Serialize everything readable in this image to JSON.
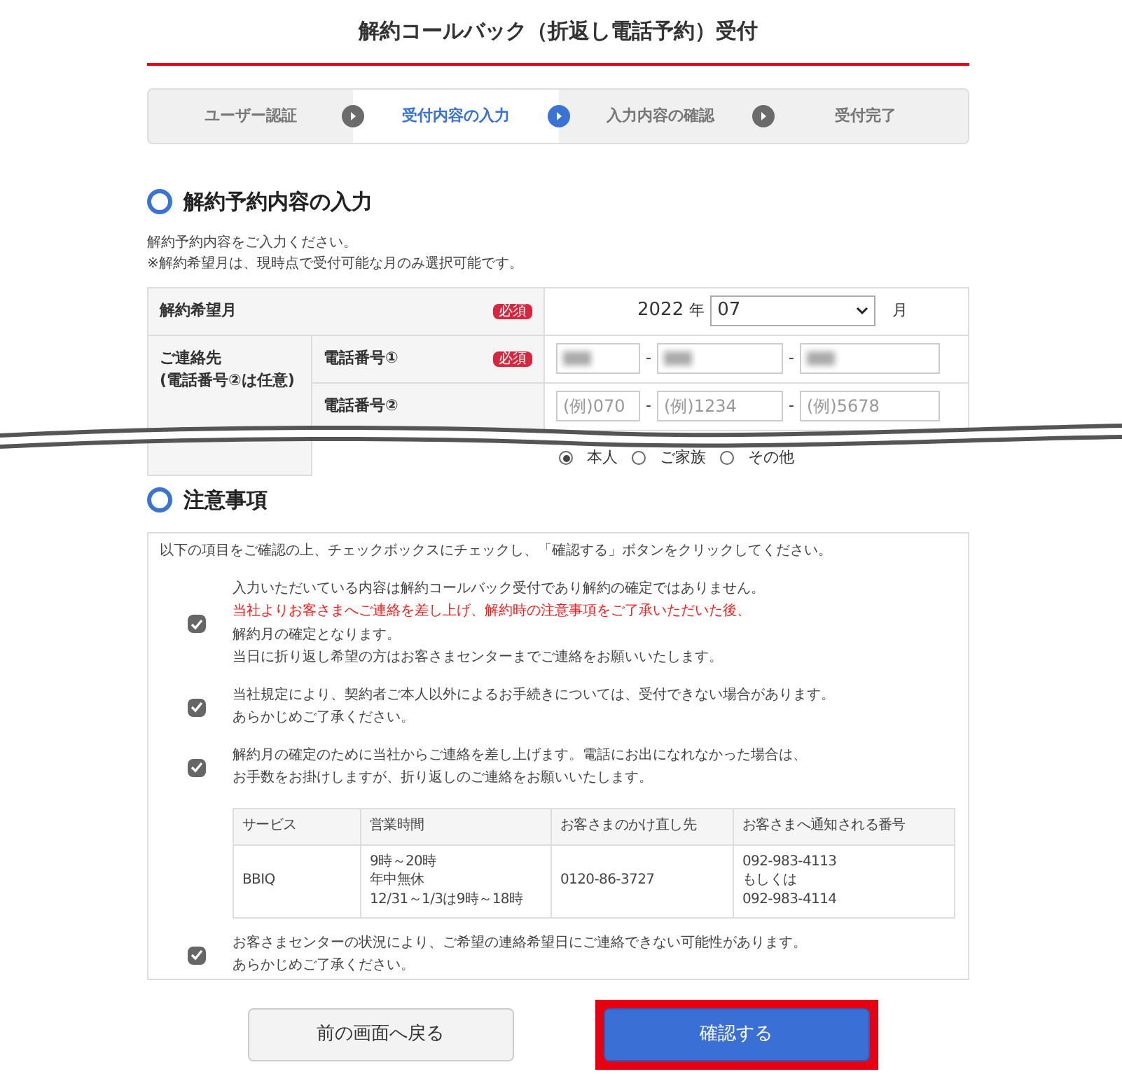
{
  "page_title": "解約コールバック（折返し電話予約）受付",
  "steps": [
    {
      "label": "ユーザー認証",
      "selected": false
    },
    {
      "label": "受付内容の入力",
      "selected": true
    },
    {
      "label": "入力内容の確認",
      "selected": false
    },
    {
      "label": "受付完了",
      "selected": false
    }
  ],
  "section1": {
    "heading": "解約予約内容の入力",
    "intro": [
      "解約予約内容をご入力ください。",
      "※解約希望月は、現時点で受付可能な月のみ選択可能です。"
    ],
    "month_row": {
      "label": "解約希望月",
      "badge": "必須",
      "year": "2022",
      "year_unit": "年",
      "month": "07",
      "month_unit": "月"
    },
    "contact": {
      "label": "ご連絡先",
      "note": "(電話番号②は任意)",
      "phones": [
        {
          "label": "電話番号①",
          "badge": "必須",
          "fields": [
            {
              "blurred": true
            },
            {
              "blurred": true
            },
            {
              "blurred": true
            }
          ],
          "separator": "-"
        },
        {
          "label": "電話番号②",
          "fields": [
            {
              "placeholder": "(例)070"
            },
            {
              "placeholder": "(例)1234"
            },
            {
              "placeholder": "(例)5678"
            }
          ],
          "separator": "-"
        }
      ]
    },
    "relation": [
      {
        "label": "本人",
        "selected": true
      },
      {
        "label": "ご家族",
        "selected": false
      },
      {
        "label": "その他",
        "selected": false
      }
    ]
  },
  "section2": {
    "heading": "注意事項",
    "intro": "以下の項目をご確認の上、チェックボックスにチェックし、「確認する」ボタンをクリックしてください。",
    "items": [
      {
        "checked": true,
        "lines": [
          {
            "text": "入力いただいている内容は解約コールバック受付であり解約の確定ではありません。",
            "warning": false
          },
          {
            "text": "当社よりお客さまへご連絡を差し上げ、解約時の注意事項をご了承いただいた後、",
            "warning": true
          },
          {
            "text": "解約月の確定となります。",
            "warning": false
          },
          {
            "text": "当日に折り返し希望の方はお客さまセンターまでご連絡をお願いいたします。",
            "warning": false
          }
        ]
      },
      {
        "checked": true,
        "lines": [
          {
            "text": "当社規定により、契約者ご本人以外によるお手続きについては、受付できない場合があります。",
            "warning": false
          },
          {
            "text": "あらかじめご了承ください。",
            "warning": false
          }
        ]
      },
      {
        "checked": true,
        "lines": [
          {
            "text": "解約月の確定のために当社からご連絡を差し上げます。電話にお出になれなかった場合は、",
            "warning": false
          },
          {
            "text": "お手数をお掛けしますが、折り返しのご連絡をお願いいたします。",
            "warning": false
          }
        ],
        "table": {
          "columns": [
            "サービス",
            "営業時間",
            "お客さまのかけ直し先",
            "お客さまへ通知される番号"
          ],
          "rows": [
            [
              [
                "BBIQ"
              ],
              [
                "9時～20時",
                "年中無休",
                "12/31～1/3は9時～18時"
              ],
              [
                "0120-86-3727"
              ],
              [
                "092-983-4113",
                "もしくは",
                "092-983-4114"
              ]
            ]
          ]
        }
      },
      {
        "checked": true,
        "lines": [
          {
            "text": "お客さまセンターの状況により、ご希望の連絡希望日にご連絡できない可能性があります。",
            "warning": false
          },
          {
            "text": "あらかじめご了承ください。",
            "warning": false
          }
        ]
      }
    ]
  },
  "buttons": [
    {
      "label": "前の画面へ戻る",
      "kind": "secondary",
      "highlighted": false
    },
    {
      "label": "確認する",
      "kind": "primary",
      "highlighted": true
    }
  ]
}
